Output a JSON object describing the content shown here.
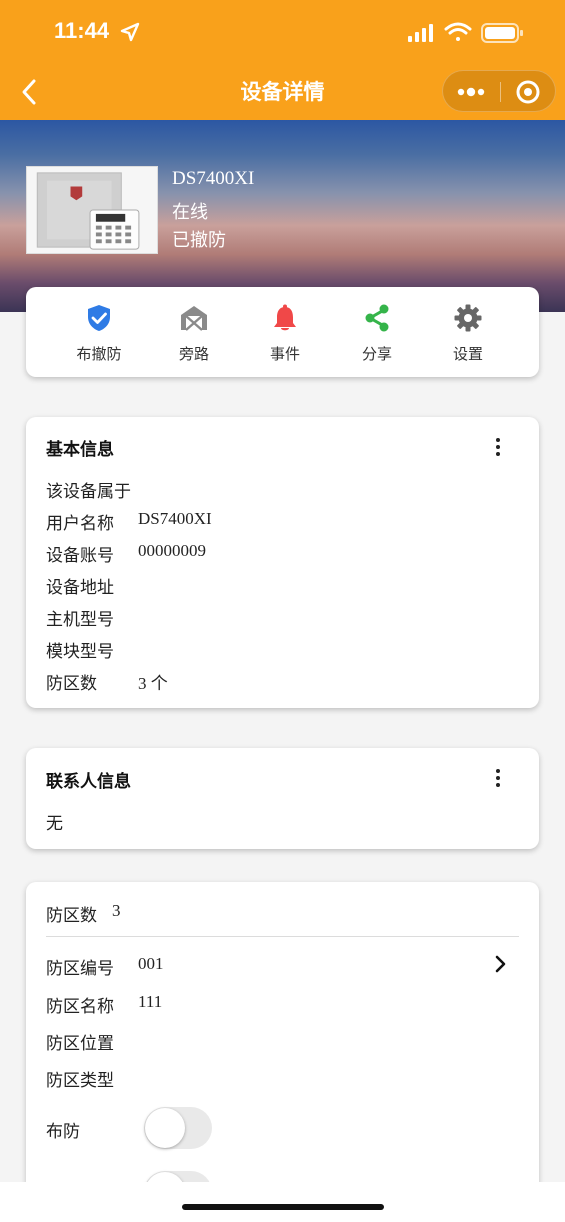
{
  "status_bar": {
    "time": "11:44"
  },
  "nav": {
    "title": "设备详情"
  },
  "device": {
    "name": "DS7400XI",
    "status": "在线",
    "arm_state": "已撤防"
  },
  "actions": [
    {
      "label": "布撤防",
      "icon": "shield-check-icon",
      "color": "#2f7be5"
    },
    {
      "label": "旁路",
      "icon": "house-bypass-icon",
      "color": "#8a8a8a"
    },
    {
      "label": "事件",
      "icon": "bell-icon",
      "color": "#f04848"
    },
    {
      "label": "分享",
      "icon": "share-icon",
      "color": "#35b44a"
    },
    {
      "label": "设置",
      "icon": "gear-icon",
      "color": "#666666"
    }
  ],
  "basic_info": {
    "title": "基本信息",
    "rows": [
      {
        "label": "该设备属于",
        "value": ""
      },
      {
        "label": "用户名称",
        "value": "DS7400XI"
      },
      {
        "label": "设备账号",
        "value": "00000009"
      },
      {
        "label": "设备地址",
        "value": ""
      },
      {
        "label": "主机型号",
        "value": ""
      },
      {
        "label": "模块型号",
        "value": ""
      },
      {
        "label": "防区数",
        "value": "3 个"
      }
    ]
  },
  "contact_info": {
    "title": "联系人信息",
    "value": "无"
  },
  "zones": {
    "count_label": "防区数",
    "count": "3",
    "rows": [
      {
        "label": "防区编号",
        "value": "001"
      },
      {
        "label": "防区名称",
        "value": "111"
      },
      {
        "label": "防区位置",
        "value": ""
      },
      {
        "label": "防区类型",
        "value": ""
      }
    ],
    "arm_label": "布防",
    "arm_on": false
  },
  "colors": {
    "accent": "#f9a11b"
  }
}
